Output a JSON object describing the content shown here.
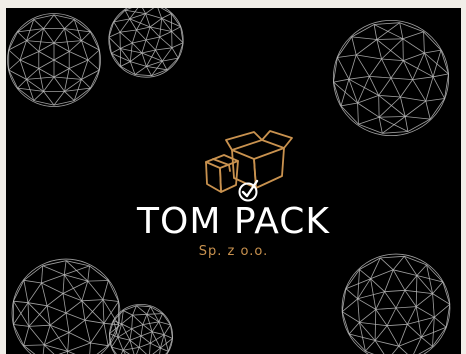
{
  "brand": {
    "name": "TOM PACK",
    "subtitle": "Sp. z o.o."
  },
  "colors": {
    "background": "#000000",
    "mesh": "#bdbdbd",
    "accent": "#c9924f",
    "text": "#ffffff"
  },
  "icons": {
    "logo": "boxes-with-checkmark-icon",
    "decoration": "geodesic-sphere-wireframe"
  }
}
